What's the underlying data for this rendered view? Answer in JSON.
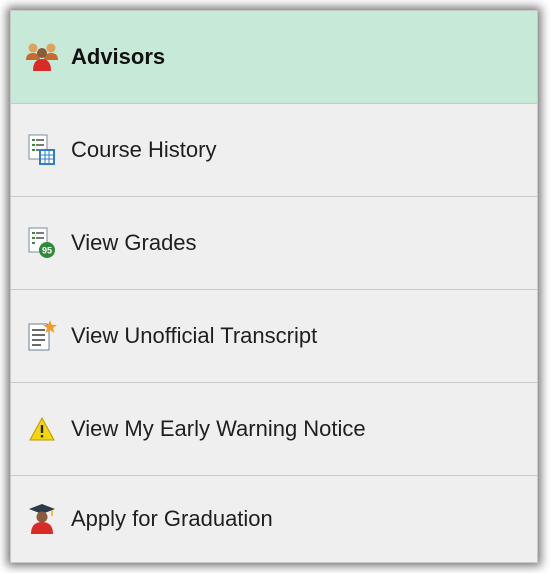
{
  "menu": {
    "items": [
      {
        "label": "Advisors",
        "icon": "advisors-icon",
        "active": true
      },
      {
        "label": "Course History",
        "icon": "course-history-icon",
        "active": false
      },
      {
        "label": "View Grades",
        "icon": "grades-icon",
        "active": false
      },
      {
        "label": "View Unofficial Transcript",
        "icon": "transcript-icon",
        "active": false
      },
      {
        "label": "View My Early Warning Notice",
        "icon": "warning-icon",
        "active": false
      },
      {
        "label": "Apply for Graduation",
        "icon": "graduation-icon",
        "active": false
      }
    ]
  },
  "colors": {
    "active_background": "#c7e9d7",
    "panel_background": "#efefef",
    "divider": "#c9c9c9"
  }
}
